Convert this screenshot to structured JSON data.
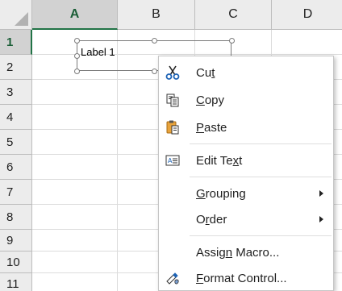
{
  "columns": [
    {
      "label": "A",
      "selected": true
    },
    {
      "label": "B",
      "selected": false
    },
    {
      "label": "C",
      "selected": false
    },
    {
      "label": "D",
      "selected": false
    }
  ],
  "rows": [
    {
      "label": "1",
      "selected": true
    },
    {
      "label": "2",
      "selected": false
    },
    {
      "label": "3",
      "selected": false
    },
    {
      "label": "4",
      "selected": false
    },
    {
      "label": "5",
      "selected": false
    },
    {
      "label": "6",
      "selected": false
    },
    {
      "label": "7",
      "selected": false
    },
    {
      "label": "8",
      "selected": false
    },
    {
      "label": "9",
      "selected": false
    },
    {
      "label": "10",
      "selected": false
    },
    {
      "label": "11",
      "selected": false
    }
  ],
  "label_control": {
    "text": "Label 1"
  },
  "context_menu": {
    "cut": {
      "label_pre": "Cu",
      "label_accel": "t",
      "label_post": "",
      "icon": "scissors-icon"
    },
    "copy": {
      "label_pre": "",
      "label_accel": "C",
      "label_post": "opy",
      "icon": "copy-icon"
    },
    "paste": {
      "label_pre": "",
      "label_accel": "P",
      "label_post": "aste",
      "icon": "clipboard-paste-icon"
    },
    "edit_text": {
      "label_pre": "Edit Te",
      "label_accel": "x",
      "label_post": "t",
      "icon": "edit-text-icon"
    },
    "grouping": {
      "label_pre": "",
      "label_accel": "G",
      "label_post": "rouping",
      "has_submenu": true
    },
    "order": {
      "label_pre": "O",
      "label_accel": "r",
      "label_post": "der",
      "has_submenu": true
    },
    "assign_macro": {
      "label_pre": "Assig",
      "label_accel": "n",
      "label_post": " Macro...",
      "icon": ""
    },
    "format_control": {
      "label_pre": "",
      "label_accel": "F",
      "label_post": "ormat Control...",
      "icon": "format-control-icon"
    }
  },
  "colors": {
    "accent_green": "#217346",
    "header_bg": "#ececec",
    "header_selected_bg": "#d2d2d2",
    "gridline": "#dcdcdc"
  }
}
